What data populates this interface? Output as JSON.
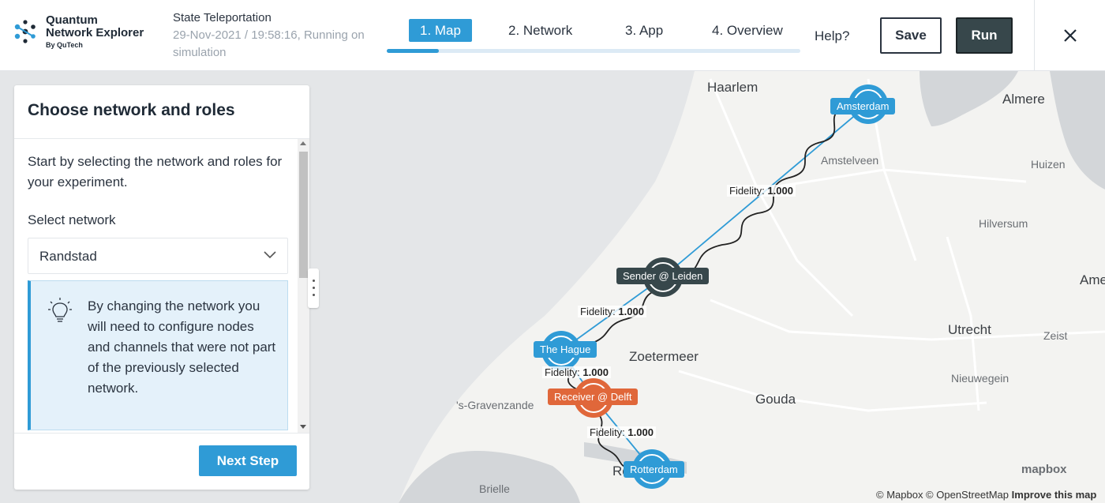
{
  "brand": {
    "line1": "Quantum",
    "line2": "Network Explorer",
    "by": "By QuTech"
  },
  "experiment": {
    "title": "State Teleportation",
    "subtitle": "29-Nov-2021 / 19:58:16, Running on simulation"
  },
  "steps": [
    {
      "label": "1. Map",
      "active": true
    },
    {
      "label": "2. Network",
      "active": false
    },
    {
      "label": "3. App",
      "active": false
    },
    {
      "label": "4. Overview",
      "active": false
    }
  ],
  "progress": 0.125,
  "header": {
    "help": "Help?",
    "save": "Save",
    "run": "Run",
    "close_icon": "close-icon"
  },
  "panel": {
    "title": "Choose network and roles",
    "intro": "Start by selecting the network and roles for your experiment.",
    "select_label": "Select network",
    "select_value": "Randstad",
    "info_icon": "lightbulb-icon",
    "info_text": "By changing the network you will need to configure nodes and channels that were not part of the previously selected network.",
    "next_button": "Next Step"
  },
  "map": {
    "cities": [
      "Haarlem",
      "Almere",
      "Amstelveen",
      "Huizen",
      "Hilversum",
      "Ame",
      "Utrecht",
      "Zeist",
      "Nieuwegein",
      "Zoetermeer",
      "Gouda",
      "'s-Gravenzande",
      "Brielle",
      "The Hague",
      "Ro"
    ],
    "nodes": [
      {
        "label": "Amsterdam",
        "role": "node",
        "color": "#2f9bd6"
      },
      {
        "label": "Sender @ Leiden",
        "role": "sender",
        "color": "#37474b"
      },
      {
        "label": "The Hague",
        "role": "node",
        "color": "#2f9bd6"
      },
      {
        "label": "Receiver @ Delft",
        "role": "receiver",
        "color": "#e0673a"
      },
      {
        "label": "Rotterdam",
        "role": "node",
        "color": "#2f9bd6"
      }
    ],
    "fidelity_label": "Fidelity:",
    "fidelities": [
      "1.000",
      "1.000",
      "1.000",
      "1.000"
    ],
    "attribution": "© Mapbox © OpenStreetMap",
    "improve": "Improve this map",
    "logo": "mapbox"
  }
}
